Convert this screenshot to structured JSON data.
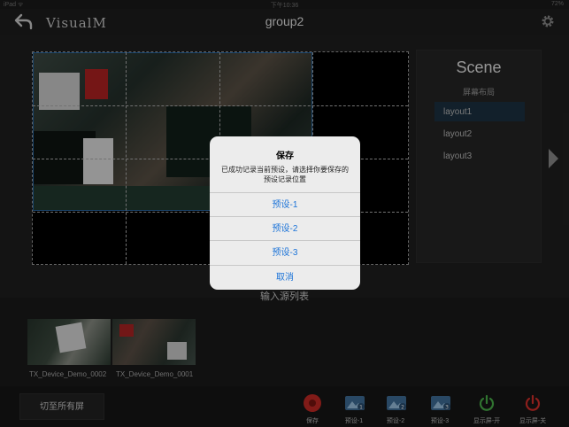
{
  "status_bar": {
    "carrier": "iPad ᯤ",
    "time": "下午10:36",
    "battery": "72%"
  },
  "header": {
    "app_name": "VisualM",
    "title": "group2"
  },
  "scene_panel": {
    "title": "Scene",
    "subtitle": "屏幕布局",
    "layouts": [
      "layout1",
      "layout2",
      "layout3"
    ],
    "selected_index": 0
  },
  "input_list": {
    "label": "输入源列表",
    "sources": [
      "TX_Device_Demo_0002",
      "TX_Device_Demo_0001"
    ]
  },
  "toolbar": {
    "switch_all": "切至所有屏",
    "items": [
      {
        "label": "保存",
        "icon": "record-icon"
      },
      {
        "label": "预设-1",
        "icon": "preset-1-icon"
      },
      {
        "label": "预设-2",
        "icon": "preset-2-icon"
      },
      {
        "label": "预设-3",
        "icon": "preset-3-icon"
      },
      {
        "label": "显示屏-开",
        "icon": "power-on-icon"
      },
      {
        "label": "显示屏-关",
        "icon": "power-off-icon"
      }
    ]
  },
  "dialog": {
    "title": "保存",
    "message_line1": "已成功记录当前预设，请选择你要保存的",
    "message_line2": "预设记录位置",
    "options": [
      "预设-1",
      "预设-2",
      "预设-3"
    ],
    "cancel": "取消"
  },
  "colors": {
    "accent": "#1b73d8",
    "selection": "#1c3242",
    "power_on": "#4bb34b",
    "power_off": "#d9302b"
  }
}
